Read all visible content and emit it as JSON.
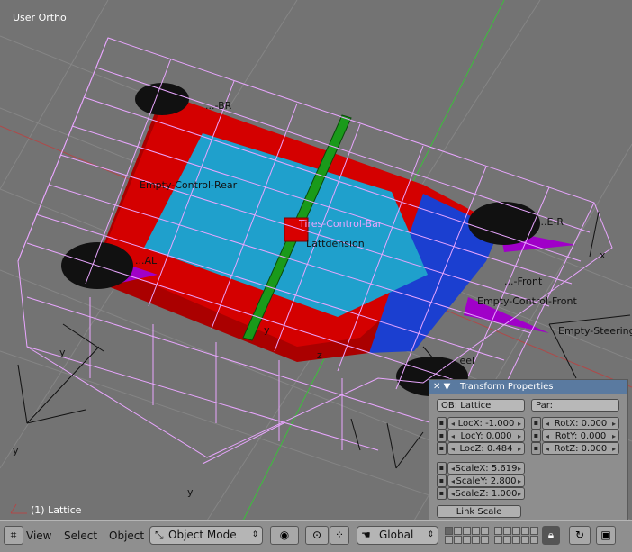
{
  "viewport": {
    "view_name": "User Ortho",
    "selection_label": "(1) Lattice",
    "scene_labels": {
      "rear_left": "Empty-Control-Rear",
      "center": "Tires-Control-Bar",
      "lattice": "Lattdension",
      "front_mid": "...-Front",
      "front_control": "Empty-Control-Front",
      "steering": "Empty-Steering",
      "top_left": "...-BR",
      "right_wheel": "...E-R",
      "left_wheel": "...AL",
      "bottom": "...eel",
      "axis_x1": "x",
      "axis_y1": "y",
      "axis_y2": "y",
      "axis_y3": "y",
      "axis_z": "z",
      "axis_y4": "y"
    }
  },
  "transform_panel": {
    "title": "Transform Properties",
    "close_glyph": "✕",
    "collapse_glyph": "▼",
    "object_name": "OB: Lattice",
    "parent": "Par:",
    "loc": [
      {
        "label": "LocX:",
        "value": "-1.000"
      },
      {
        "label": "LocY:",
        "value": "0.000"
      },
      {
        "label": "LocZ:",
        "value": "0.484"
      }
    ],
    "rot": [
      {
        "label": "RotX:",
        "value": "0.000"
      },
      {
        "label": "RotY:",
        "value": "0.000"
      },
      {
        "label": "RotZ:",
        "value": "0.000"
      }
    ],
    "scale": [
      {
        "label": "ScaleX:",
        "value": "5.619"
      },
      {
        "label": "ScaleY:",
        "value": "2.800"
      },
      {
        "label": "ScaleZ:",
        "value": "1.000"
      }
    ],
    "link_scale": "Link Scale"
  },
  "header": {
    "menu": [
      "View",
      "Select",
      "Object"
    ],
    "mode": "Object Mode",
    "orientation": "Global",
    "icons": {
      "window_type": "view3d-icon",
      "draw_type": "solid-draw-icon",
      "pivot": "pivot-icon",
      "snap": "snap-icon",
      "manipulator": "hand-icon",
      "lock": "lock-icon",
      "link": "link-icon",
      "render": "render-icon"
    }
  },
  "colors": {
    "viewport_bg": "#737373",
    "lattice": "#e9a6ff",
    "car_body": "#cc0000",
    "car_top": "#2196c8",
    "car_blue": "#1a3fd0",
    "bar": "#1a9a1a",
    "panel_header": "#5a7aa0"
  }
}
